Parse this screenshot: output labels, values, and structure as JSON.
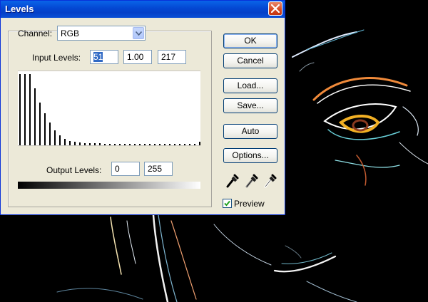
{
  "dialog": {
    "title": "Levels",
    "channel_label": "Channel:",
    "channel_value": "RGB",
    "input_levels_label": "Input Levels:",
    "input_black": "51",
    "input_gamma": "1.00",
    "input_white": "217",
    "output_levels_label": "Output Levels:",
    "output_black": "0",
    "output_white": "255",
    "histogram_heights": [
      1.0,
      1.0,
      1.0,
      0.8,
      0.6,
      0.45,
      0.32,
      0.21,
      0.14,
      0.09,
      0.06,
      0.05,
      0.04,
      0.03,
      0.03,
      0.03,
      0.03,
      0.02,
      0.02,
      0.02,
      0.02,
      0.02,
      0.02,
      0.02,
      0.02,
      0.02,
      0.02,
      0.02,
      0.02,
      0.02,
      0.02,
      0.02,
      0.02,
      0.02,
      0.02,
      0.02,
      0.05
    ]
  },
  "buttons": {
    "ok": "OK",
    "cancel": "Cancel",
    "load": "Load...",
    "save": "Save...",
    "auto": "Auto",
    "options": "Options..."
  },
  "preview": {
    "label": "Preview",
    "checked": true
  },
  "colors": {
    "title_blue": "#0447d2",
    "dialog_bg": "#ece9d8",
    "selection": "#316ac5"
  }
}
